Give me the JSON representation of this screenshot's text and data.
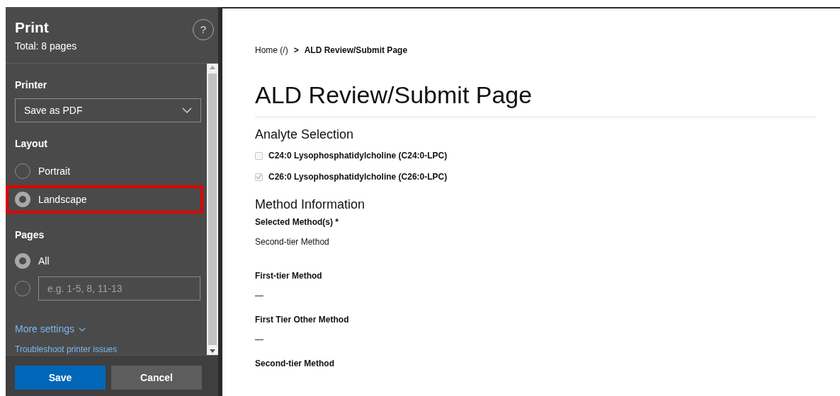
{
  "print_panel": {
    "title": "Print",
    "subtitle": "Total: 8 pages",
    "help": "?",
    "printer": {
      "label": "Printer",
      "value": "Save as PDF"
    },
    "layout": {
      "label": "Layout",
      "options": [
        {
          "label": "Portrait",
          "selected": false,
          "highlighted": false
        },
        {
          "label": "Landscape",
          "selected": true,
          "highlighted": true
        }
      ]
    },
    "pages": {
      "label": "Pages",
      "options": [
        {
          "kind": "label",
          "label": "All",
          "selected": true
        },
        {
          "kind": "field",
          "placeholder": "e.g. 1-5, 8, 11-13",
          "selected": false
        }
      ]
    },
    "more_settings": "More settings",
    "troubleshoot": "Troubleshoot printer issues",
    "buttons": [
      {
        "label": "Save",
        "kind": "primary"
      },
      {
        "label": "Cancel",
        "kind": "secondary"
      }
    ]
  },
  "page": {
    "breadcrumb": [
      {
        "label": "Home (/)",
        "current": false
      },
      {
        "label": "ALD Review/Submit Page",
        "current": true
      }
    ],
    "breadcrumb_separator": ">",
    "title": "ALD Review/Submit Page",
    "sections": [
      {
        "heading": "Analyte Selection",
        "checkboxes": [
          {
            "label": "C24:0 Lysophosphatidylcholine (C24:0-LPC)",
            "checked": false
          },
          {
            "label": "C26:0 Lysophosphatidylcholine (C26:0-LPC)",
            "checked": true
          }
        ]
      },
      {
        "heading": "Method Information",
        "fields": [
          {
            "label": "Selected Method(s) *",
            "value": "Second-tier Method"
          },
          {
            "label": "First-tier Method",
            "value": "—"
          },
          {
            "label": "First Tier Other Method",
            "value": "—"
          },
          {
            "label": "Second-tier Method"
          }
        ]
      }
    ]
  }
}
